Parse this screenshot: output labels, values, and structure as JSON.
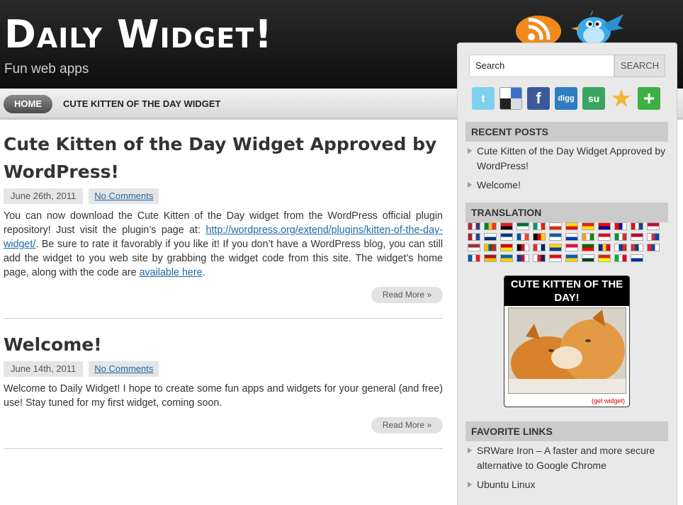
{
  "header": {
    "title": "Daily Widget!",
    "tagline": "Fun web apps"
  },
  "nav": {
    "home": "HOME",
    "item": "CUTE KITTEN OF THE DAY WIDGET"
  },
  "posts": [
    {
      "title": "Cute Kitten of the Day Widget Approved by WordPress!",
      "date": "June 26th, 2011",
      "comments": "No Comments",
      "body_1": "You can now download the Cute Kitten of the Day widget from the WordPress official plugin repository! Just visit the plugin’s page at: ",
      "link_1": "http://wordpress.org/extend/plugins/kitten-of-the-day-widget/",
      "body_2": ". Be sure to rate it favorably if you like it! If you don’t have a WordPress blog, you can still add the widget to you web site by grabbing the widget code from this site. The widget’s home page, along with the code are ",
      "link_2": "available here",
      "body_3": ".",
      "read_more": "Read More »"
    },
    {
      "title": "Welcome!",
      "date": "June 14th, 2011",
      "comments": "No Comments",
      "body": "Welcome to Daily Widget! I hope to create some fun apps and widgets for your general (and free) use! Stay tuned for my first widget, coming soon.",
      "read_more": "Read More »"
    }
  ],
  "sidebar": {
    "search_value": "Search",
    "search_button": "SEARCH",
    "social_icons": [
      "twitter-icon",
      "delicious-icon",
      "facebook-icon",
      "digg-icon",
      "stumbleupon-icon",
      "favorite-star-icon",
      "add-plus-icon"
    ],
    "recent_posts_title": "RECENT POSTS",
    "recent_posts": [
      "Cute Kitten of the Day Widget Approved by WordPress!",
      "Welcome!"
    ],
    "translation_title": "TRANSLATION",
    "kitten_title": "CUTE KITTEN OF THE DAY!",
    "kitten_credit": "(get widget)",
    "favorite_links_title": "FAVORITE LINKS",
    "favorite_links": [
      "SRWare Iron – A faster and more secure alternative to Google Chrome",
      "Ubuntu Linux"
    ]
  },
  "colors": {
    "accent_link": "#1e6aa8",
    "header_bg": "#111111",
    "sidebar_bg": "#e9e9e9"
  }
}
